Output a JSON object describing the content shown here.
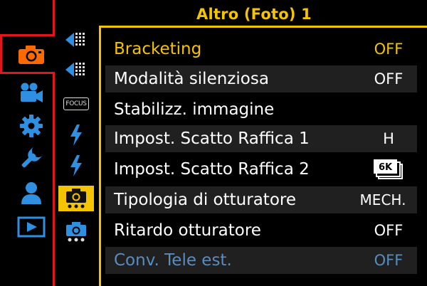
{
  "menu": {
    "title": "Altro (Foto) 1",
    "items": [
      {
        "label": "Bracketing",
        "value": "OFF"
      },
      {
        "label": "Modalità silenziosa",
        "value": "OFF"
      },
      {
        "label": "Stabilizz. immagine",
        "value": ""
      },
      {
        "label": "Impost. Scatto Raffica 1",
        "value": "H"
      },
      {
        "label": "Impost. Scatto Raffica 2",
        "value": "",
        "value_icon": "6k-burst-icon"
      },
      {
        "label": "Tipologia di otturatore",
        "value": "MECH."
      },
      {
        "label": "Ritardo otturatore",
        "value": "OFF"
      },
      {
        "label": "Conv. Tele est.",
        "value": "OFF"
      }
    ]
  },
  "sidebar": {
    "main_tabs": [
      {
        "icon": "camera-icon",
        "active": true
      },
      {
        "icon": "video-camera-icon"
      },
      {
        "icon": "gear-icon"
      },
      {
        "icon": "wrench-icon"
      },
      {
        "icon": "person-icon"
      },
      {
        "icon": "playback-icon"
      }
    ],
    "sub_tabs": [
      {
        "icon": "exposure-cursor-icon"
      },
      {
        "icon": "exposure-cursor-icon"
      },
      {
        "icon": "focus-icon",
        "label": "FOCUS"
      },
      {
        "icon": "flash-icon"
      },
      {
        "icon": "flash-icon"
      },
      {
        "icon": "camera-other-icon",
        "active": true
      },
      {
        "icon": "camera-other-icon"
      }
    ]
  },
  "colors": {
    "accent": "#f5c400",
    "tab_highlight": "#e2161c",
    "main_icon": "#2f8fe0",
    "disabled_text": "#5a8cc0",
    "row_background": "#202020"
  }
}
